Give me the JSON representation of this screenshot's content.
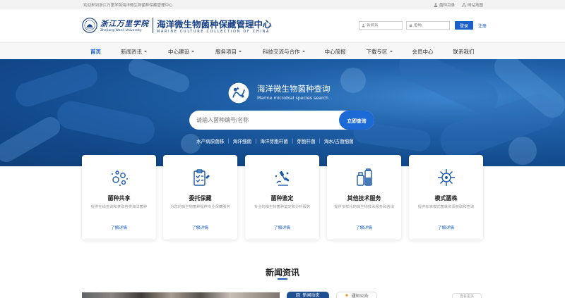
{
  "topbar": {
    "welcome": "欢迎来到浙江万里学院海洋微生物菌种保藏管理中心",
    "links": [
      {
        "icon": "person-icon",
        "label": "菌种目录"
      },
      {
        "icon": "sitemap-icon",
        "label": "网站地图"
      }
    ]
  },
  "header": {
    "school_cn": "浙江万里学院",
    "school_en": "Zhejiang Wanli University",
    "center_cn": "海洋微生物菌种保藏管理中心",
    "center_en": "MARINE CULTURE COLLECTION OF CHINA",
    "username_placeholder": "会员名",
    "password_placeholder": "密码",
    "login_label": "登录",
    "register_label": "注册"
  },
  "nav": {
    "items": [
      {
        "label": "首页",
        "dropdown": false,
        "active": true
      },
      {
        "label": "新闻资讯",
        "dropdown": true,
        "active": false
      },
      {
        "label": "中心建设",
        "dropdown": true,
        "active": false
      },
      {
        "label": "服务项目",
        "dropdown": true,
        "active": false
      },
      {
        "label": "科技交流与合作",
        "dropdown": true,
        "active": false
      },
      {
        "label": "中心简报",
        "dropdown": false,
        "active": false
      },
      {
        "label": "下载专区",
        "dropdown": true,
        "active": false
      },
      {
        "label": "会员中心",
        "dropdown": false,
        "active": false
      },
      {
        "label": "联系我们",
        "dropdown": false,
        "active": false
      }
    ]
  },
  "hero": {
    "title": "海洋微生物菌种查询",
    "subtitle": "Marine microbial species search",
    "search_placeholder": "请输入菌种编号/名称",
    "search_button": "立即查询",
    "tags": [
      "水产病原菌株",
      "海洋细菌",
      "海洋芽胞杆菌",
      "芽胞杆菌",
      "海水/古菌细菌"
    ]
  },
  "services": [
    {
      "icon": "bubbles-icon",
      "title": "菌种共享",
      "desc": "提供在线查询和获取各类海洋菌种",
      "more": "了解详情"
    },
    {
      "icon": "clipboard-icon",
      "title": "委托保藏",
      "desc": "为您的微生物菌种提供专业保藏服务",
      "more": "了解详情"
    },
    {
      "icon": "microscope-icon",
      "title": "菌种鉴定",
      "desc": "专业的微生物菌种鉴定和分析服务",
      "more": "了解详情"
    },
    {
      "icon": "bottles-icon",
      "title": "其他技术服务",
      "desc": "提供多样化的微生物技术服务和咨询",
      "more": "了解详情"
    },
    {
      "icon": "virus-icon",
      "title": "模式菌株",
      "desc": "提供标准模式菌株资源获取和查询",
      "more": "了解详情"
    }
  ],
  "news": {
    "title": "新闻资讯",
    "tab_active": "新闻动态",
    "tab_other": "通知公告",
    "more": "查看更多"
  },
  "colors": {
    "brand": "#173f86",
    "accent": "#1b60c6",
    "hero_dark": "#124a8c"
  }
}
